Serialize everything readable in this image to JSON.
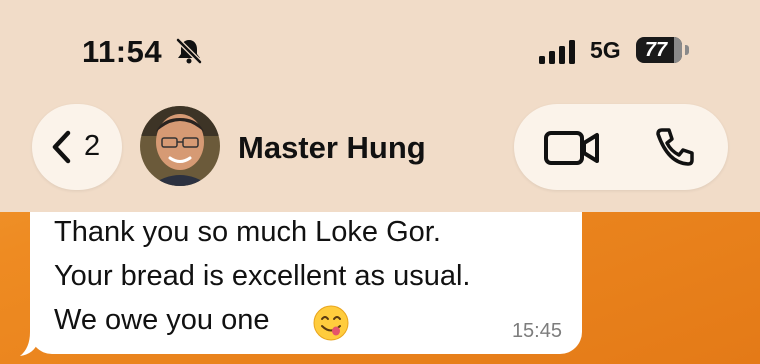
{
  "status_bar": {
    "time": "11:54",
    "network": "5G",
    "battery": "77",
    "icons": [
      "bell-slash-icon",
      "signal-bars-icon",
      "battery-icon"
    ]
  },
  "header": {
    "back_count": "2",
    "contact_name": "Master Hung",
    "icons": [
      "chevron-left-icon",
      "video-camera-icon",
      "phone-icon"
    ]
  },
  "message": {
    "lines": [
      "Thank you so much Loke Gor.",
      "Your bread is excellent as usual.",
      "We owe you one"
    ],
    "emoji": "face-savoring-food",
    "time": "15:45"
  },
  "colors": {
    "header_bg": "#f1dcc8",
    "wallpaper": "#ee8b22",
    "bubble": "#ffffff"
  }
}
